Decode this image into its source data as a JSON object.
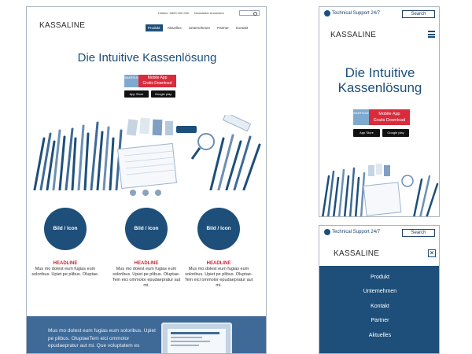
{
  "desktop": {
    "logo": "KASSALINE",
    "phone": "Hotline: 0800 000 000",
    "register": "Newsletter Anmelden",
    "nav": [
      "Produkt",
      "Aktuelles",
      "Unternehmen",
      "Partner",
      "Kontakt"
    ],
    "hero_title": "Die Intuitive Kassenlösung",
    "app_badge_left": "SMARTKASSEN",
    "app_badge_line1": "Mobile App",
    "app_badge_line2": "Gratis Download",
    "store1": "App Store",
    "store2": "Google play",
    "features": [
      {
        "icon": "Bild / Icon",
        "headline": "HEADLINE",
        "text": "Mus mo dolest eum fugias eum soloribus. Upiet pe plibus. Oluptae."
      },
      {
        "icon": "Bild / Icon",
        "headline": "HEADLINE",
        "text": "Mus mo dolest eum fugias eum soloribus. Upiet pe plibus. Oluptae-Tem eici ommolor epudaepratur aut mi."
      },
      {
        "icon": "Bild / Icon",
        "headline": "HEADLINE",
        "text": "Mus mo dolest eum fugias eum soloribus. Upiet pe plibus. Oluptae-Tem eici ommolor epudaepratur aut mi."
      }
    ],
    "footer_text": "Mus mo dolest eum fugias eum soloribus. Upiet pe plibus. OluptaeTem eici ommolor epudaepratur aut mi. Que voluptatem es"
  },
  "mobile": {
    "support": "Technical Support 24/7",
    "search": "Search",
    "logo": "KASSALINE",
    "hero_title_line1": "Die Intuitive",
    "hero_title_line2": "Kassenlösung",
    "menu": [
      "Produkt",
      "Unternehmen",
      "Kontakt",
      "Partner",
      "Aktuelles"
    ]
  },
  "colors": {
    "primary": "#1d4f7a",
    "accent": "#c0283b",
    "footer": "#3f6a98"
  }
}
